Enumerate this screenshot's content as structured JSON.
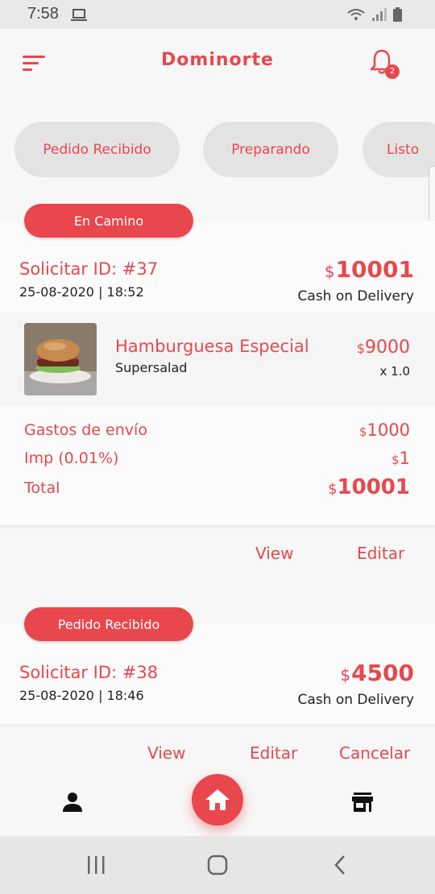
{
  "status_bar": {
    "time": "7:58"
  },
  "app": {
    "title": "Dominorte",
    "notification_count": "2"
  },
  "filters": [
    {
      "label": "Pedido Recibido"
    },
    {
      "label": "Preparando"
    },
    {
      "label": "Listo"
    }
  ],
  "orders": [
    {
      "status": "En Camino",
      "id_label": "Solicitar ID: #37",
      "datetime": "25-08-2020 | 18:52",
      "currency": "$",
      "total": "10001",
      "payment": "Cash on Delivery",
      "item": {
        "name": "Hamburguesa Especial",
        "sub": "Supersalad",
        "currency": "$",
        "price": "9000",
        "qty": "x 1.0"
      },
      "summary": {
        "shipping_label": "Gastos de envío",
        "shipping_value": "1000",
        "tax_label": "Imp (0.01%)",
        "tax_value": "1",
        "total_label": "Total",
        "total_value": "10001",
        "currency": "$"
      },
      "actions": {
        "view": "View",
        "edit": "Editar"
      }
    },
    {
      "status": "Pedido Recibido",
      "id_label": "Solicitar ID: #38",
      "datetime": "25-08-2020 | 18:46",
      "currency": "$",
      "total": "4500",
      "payment": "Cash on Delivery",
      "actions": {
        "view": "View",
        "edit": "Editar",
        "cancel": "Cancelar"
      }
    }
  ],
  "bottom_nav": {
    "left": "person-icon",
    "center": "home-icon",
    "right": "store-icon"
  },
  "colors": {
    "accent": "#e8474d",
    "chip_bg": "#e3e3e3",
    "background": "#f7f7f7"
  }
}
